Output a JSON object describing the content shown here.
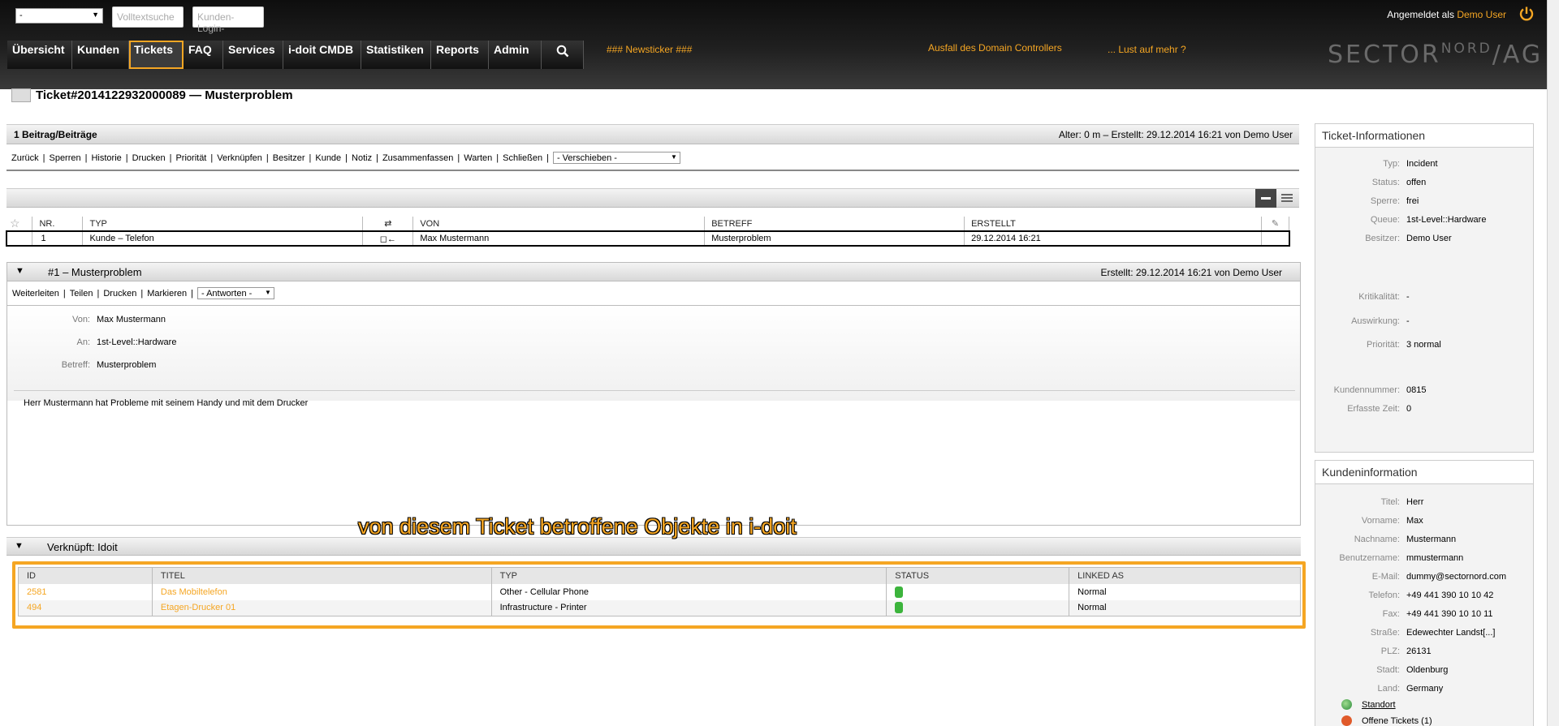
{
  "topbar": {
    "queue_select": "-",
    "fulltext_placeholder": "Volltextsuche",
    "customer_login_placeholder": "Kunden-Login-",
    "logged_in_label": "Angemeldet als",
    "user": "Demo User",
    "nav": [
      "Übersicht",
      "Kunden",
      "Tickets",
      "FAQ",
      "Services",
      "i-doit CMDB",
      "Statistiken",
      "Reports",
      "Admin"
    ],
    "active_nav": "Tickets",
    "search_icon": "search-icon",
    "ticker": [
      "### Newsticker ###",
      "Ausfall des Domain Controllers",
      "... Lust auf mehr ?"
    ],
    "logo_left": "SECTOR",
    "logo_mid": "NORD",
    "logo_right": "AG",
    "accent": "#f5a623"
  },
  "ticket": {
    "title": "Ticket#2014122932000089  —  Musterproblem",
    "article_count": "1 Beitrag/Beiträge",
    "age": "Alter: 0 m – Erstellt: 29.12.2014 16:21 von Demo User",
    "actions": [
      "Zurück",
      "Sperren",
      "Historie",
      "Drucken",
      "Priorität",
      "Verknüpfen",
      "Besitzer",
      "Kunde",
      "Notiz",
      "Zusammenfassen",
      "Warten",
      "Schließen"
    ],
    "move_select": "- Verschieben -"
  },
  "articles": {
    "headers": [
      "NR.",
      "TYP",
      "⇄",
      "VON",
      "BETREFF",
      "ERSTELLT"
    ],
    "rows": [
      {
        "nr": "1",
        "typ": "Kunde – Telefon",
        "dir": "◻←",
        "von": "Max Mustermann",
        "betreff": "Musterproblem",
        "erstellt": "29.12.2014 16:21"
      }
    ]
  },
  "article": {
    "title": "#1 – Musterproblem",
    "created": "Erstellt: 29.12.2014 16:21 von Demo User",
    "actions": [
      "Weiterleiten",
      "Teilen",
      "Drucken",
      "Markieren"
    ],
    "reply_select": "- Antworten -",
    "von_label": "Von:",
    "von": "Max Mustermann",
    "an_label": "An:",
    "an": "1st-Level::Hardware",
    "betreff_label": "Betreff:",
    "betreff": "Musterproblem",
    "body": "Herr Mustermann hat Probleme mit seinem Handy und mit dem Drucker"
  },
  "linked": {
    "title": "Verknüpft: Idoit",
    "callout": "von diesem Ticket betroffene Objekte in i-doit",
    "headers": [
      "ID",
      "TITEL",
      "TYP",
      "STATUS",
      "LINKED AS"
    ],
    "rows": [
      {
        "id": "2581",
        "titel": "Das Mobiltelefon",
        "typ": "Other - Cellular Phone",
        "linked": "Normal"
      },
      {
        "id": "494",
        "titel": "Etagen-Drucker 01",
        "typ": "Infrastructure - Printer",
        "linked": "Normal"
      }
    ]
  },
  "ticketinfo": {
    "title": "Ticket-Informationen",
    "typ_l": "Typ:",
    "typ": "Incident",
    "status_l": "Status:",
    "status": "offen",
    "sperre_l": "Sperre:",
    "sperre": "frei",
    "queue_l": "Queue:",
    "queue": "1st-Level::Hardware",
    "besitzer_l": "Besitzer:",
    "besitzer": "Demo User",
    "krit_l": "Kritikalität:",
    "krit": "-",
    "ausw_l": "Auswirkung:",
    "ausw": "-",
    "prio_l": "Priorität:",
    "prio": "3 normal",
    "knr_l": "Kundennummer:",
    "knr": "0815",
    "zeit_l": "Erfasste Zeit:",
    "zeit": "0"
  },
  "customer": {
    "title": "Kundeninformation",
    "titel_l": "Titel:",
    "titel": "Herr",
    "vorname_l": "Vorname:",
    "vorname": "Max",
    "nachname_l": "Nachname:",
    "nachname": "Mustermann",
    "benutzer_l": "Benutzername:",
    "benutzer": "mmustermann",
    "email_l": "E-Mail:",
    "email": "dummy@sectornord.com",
    "tel_l": "Telefon:",
    "tel": "+49 441 390 10 10 42",
    "fax_l": "Fax:",
    "fax": "+49 441 390 10 10 11",
    "strasse_l": "Straße:",
    "strasse": "Edewechter Landst[...]",
    "plz_l": "PLZ:",
    "plz": "26131",
    "stadt_l": "Stadt:",
    "stadt": "Oldenburg",
    "land_l": "Land:",
    "land": "Germany",
    "standort": "Standort",
    "offene": "Offene Tickets (1)"
  }
}
